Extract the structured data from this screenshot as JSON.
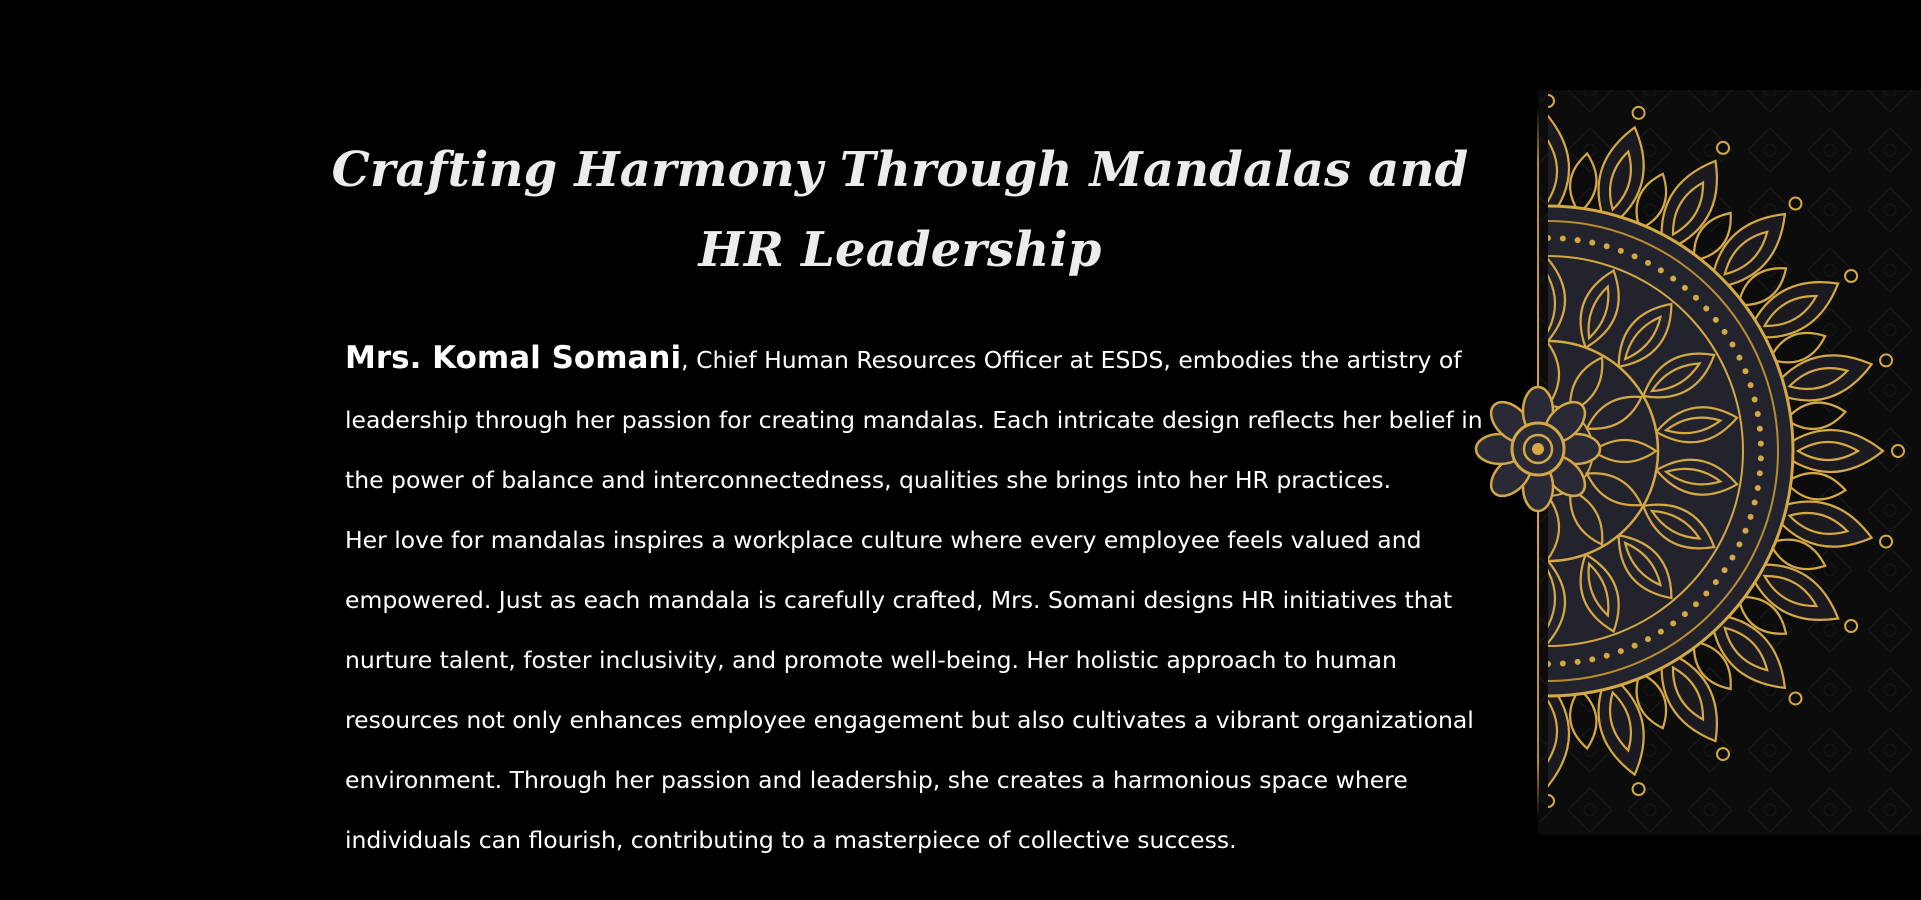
{
  "banner": {
    "headline": "Crafting Harmony Through Mandalas and HR Leadership",
    "name": "Mrs. Komal Somani",
    "paragraph1_rest": ", Chief Human Resources Officer at ESDS, embodies the artistry of leadership through her passion for creating mandalas. Each intricate design reflects her belief in the power of balance and interconnectedness, qualities she brings into her HR practices.",
    "paragraph2": "Her love for mandalas inspires a workplace culture where every employee feels valued and empowered. Just as each mandala is carefully crafted, Mrs. Somani designs HR initiatives that nurture talent, foster inclusivity, and promote well-being. Her holistic approach to human resources not only enhances employee engagement but also cultivates a vibrant organizational environment. Through her passion and leadership, she creates a harmonious space where individuals can flourish, contributing to a masterpiece of collective success."
  },
  "colors": {
    "background": "#000000",
    "text": "#ffffff",
    "headline": "#ececec",
    "gold": "#d4a843",
    "gold_dark": "#9c7423",
    "mandala_fill": "#23232e"
  },
  "decoration": {
    "icon": "mandala-icon"
  }
}
